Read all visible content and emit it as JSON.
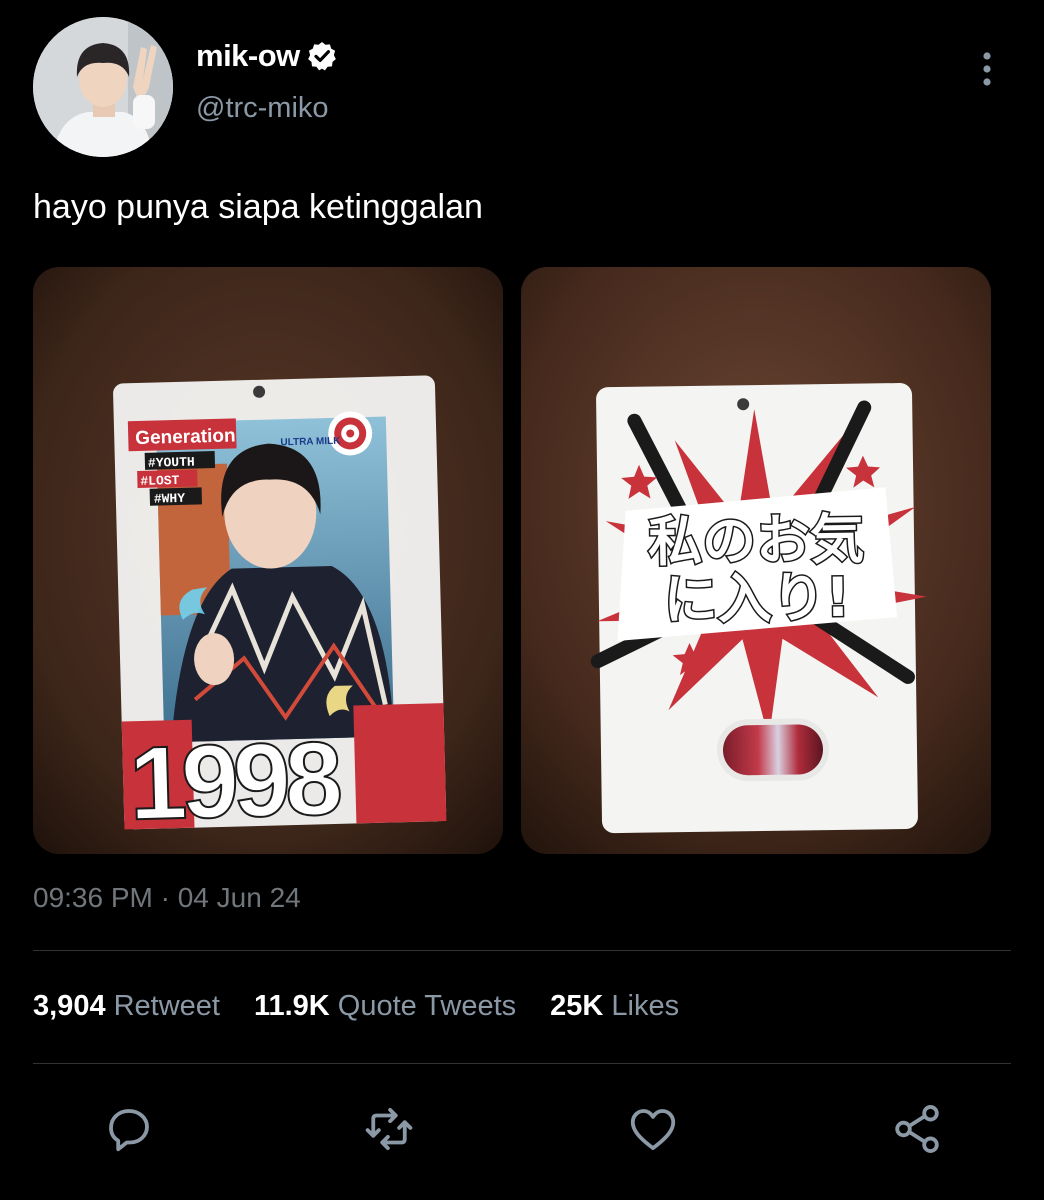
{
  "tweet": {
    "display_name": "mik-ow",
    "handle": "@trc-miko",
    "text": "hayo punya siapa ketinggalan",
    "timestamp": "09:36 PM · 04 Jun 24",
    "verified": true
  },
  "photos": {
    "left": {
      "banner_title": "Generation",
      "hashtags": [
        "#YOUTH",
        "#LOST",
        "#WHY"
      ],
      "small_logo": "ULTRA MILK",
      "year": "1998"
    },
    "right": {
      "text_line1": "私のお気",
      "text_line2": "に入り!"
    }
  },
  "stats": {
    "retweets": {
      "count": "3,904",
      "label": "Retweet"
    },
    "quotes": {
      "count": "11.9K",
      "label": "Quote Tweets"
    },
    "likes": {
      "count": "25K",
      "label": "Likes"
    }
  },
  "actions": [
    "reply-icon",
    "retweet-icon",
    "like-icon",
    "share-icon"
  ],
  "colors": {
    "background": "#000000",
    "secondary_text": "#8b98a5",
    "divider": "#2f3336"
  }
}
